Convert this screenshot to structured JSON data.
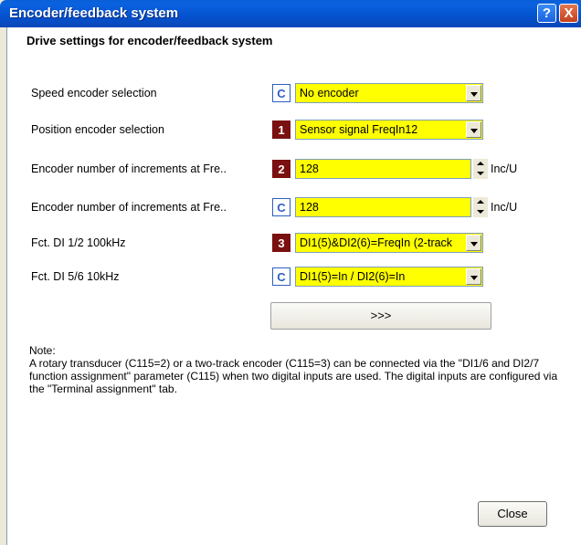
{
  "window": {
    "title": "Encoder/feedback system",
    "help_label": "?",
    "close_label": "X"
  },
  "section_title": "Drive settings for encoder/feedback system",
  "rows": [
    {
      "label": "Speed encoder selection",
      "badge": "C",
      "value": "No encoder"
    },
    {
      "label": "Position encoder selection",
      "badge": "1",
      "value": "Sensor signal FreqIn12"
    },
    {
      "label": "Encoder number of increments at Fre..",
      "badge": "2",
      "value": "128",
      "unit": "Inc/U"
    },
    {
      "label": "Encoder number of increments at Fre..",
      "badge": "C",
      "value": "128",
      "unit": "Inc/U"
    },
    {
      "label": "Fct. DI 1/2 100kHz",
      "badge": "3",
      "value": "DI1(5)&DI2(6)=FreqIn (2-track"
    },
    {
      "label": "Fct. DI 5/6 10kHz",
      "badge": "C",
      "value": "DI1(5)=In / DI2(6)=In"
    }
  ],
  "more_button": ">>>",
  "note": {
    "heading": "Note:",
    "text": "A rotary transducer (C115=2) or a two-track encoder (C115=3) can be connected via the \"DI1/6 and DI2/7 function assignment\" parameter (C115) when two digital inputs are used. The digital inputs are configured via the \"Terminal assignment\" tab."
  },
  "close_button": "Close",
  "colors": {
    "highlight": "#ffff00",
    "badge_number": "#7a1010",
    "badge_c": "#2e5fc0",
    "title_bar": "#0453d0"
  }
}
